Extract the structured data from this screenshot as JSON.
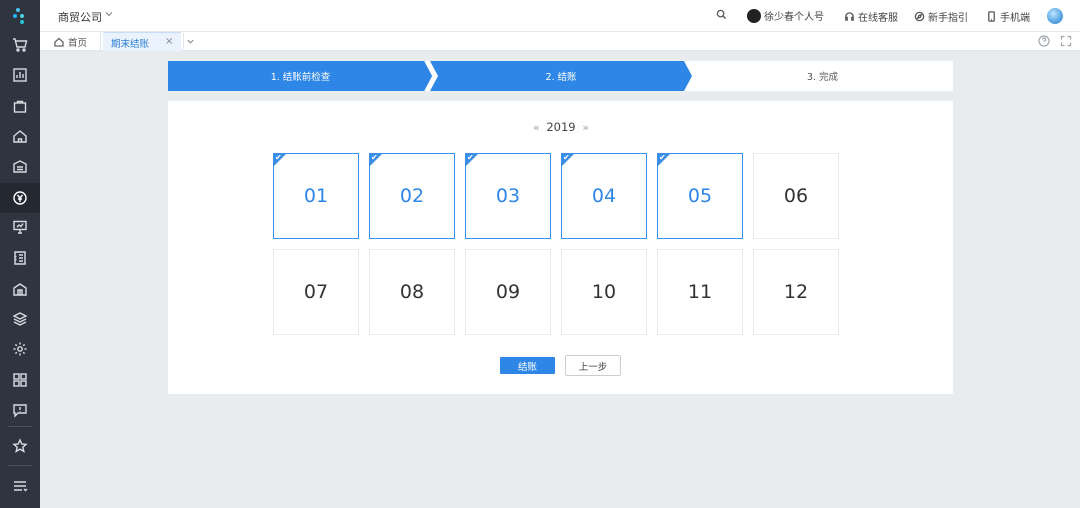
{
  "header": {
    "company": "商贸公司",
    "user": "徐少春个人号",
    "support": "在线客服",
    "guide": "新手指引",
    "mobile": "手机端"
  },
  "tabs": {
    "home": "首页",
    "active": "期末结账",
    "close": "×"
  },
  "steps": [
    {
      "label": "1. 结账前检查",
      "state": "done"
    },
    {
      "label": "2. 结账",
      "state": "current"
    },
    {
      "label": "3. 完成",
      "state": "pending"
    }
  ],
  "calendar": {
    "year": "2019",
    "prev": "«",
    "next": "»",
    "months": [
      {
        "label": "01",
        "closed": true
      },
      {
        "label": "02",
        "closed": true
      },
      {
        "label": "03",
        "closed": true
      },
      {
        "label": "04",
        "closed": true
      },
      {
        "label": "05",
        "closed": true
      },
      {
        "label": "06",
        "closed": false
      },
      {
        "label": "07",
        "closed": false
      },
      {
        "label": "08",
        "closed": false
      },
      {
        "label": "09",
        "closed": false
      },
      {
        "label": "10",
        "closed": false
      },
      {
        "label": "11",
        "closed": false
      },
      {
        "label": "12",
        "closed": false
      }
    ]
  },
  "actions": {
    "close_label": "结账",
    "back_label": "上一步"
  },
  "sidebar": {
    "icons": [
      "logo-icon",
      "cart-icon",
      "chart-icon",
      "bag-icon",
      "home-icon",
      "warehouse-icon",
      "yen-icon",
      "presentation-icon",
      "ticket-icon",
      "building-icon",
      "layers-icon",
      "settings-icon",
      "apps-icon",
      "message-icon",
      "star-icon",
      "menu-icon"
    ]
  },
  "colors": {
    "accent": "#2e86e6",
    "sidebar": "#2f3540",
    "background": "#e9ecef"
  }
}
